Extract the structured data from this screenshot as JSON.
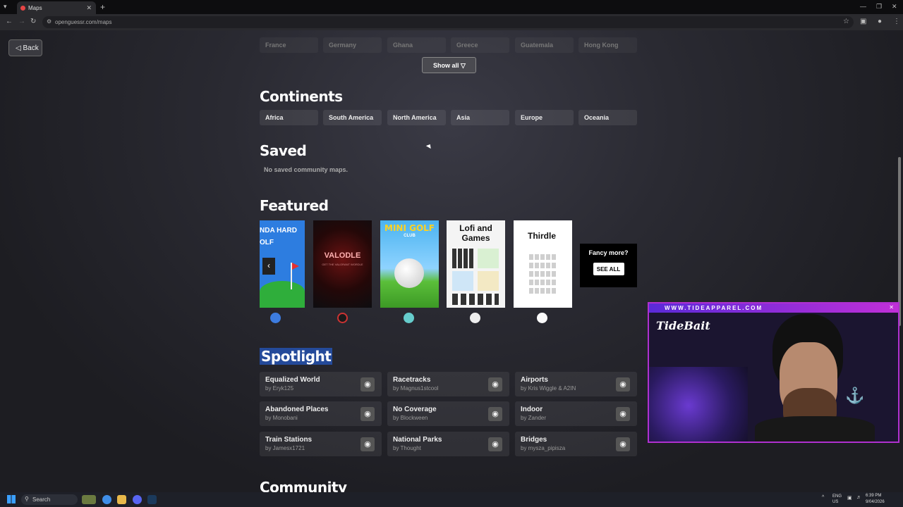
{
  "browser": {
    "tab_title": "Maps",
    "url": "openguessr.com/maps",
    "new_tab_icon": "plus-icon"
  },
  "page": {
    "back_label": "Back",
    "countries_row": [
      "France",
      "Germany",
      "Ghana",
      "Greece",
      "Guatemala",
      "Hong Kong"
    ],
    "show_all_label": "Show all ▽",
    "continents_title": "Continents",
    "continents": [
      "Africa",
      "South America",
      "North America",
      "Asia",
      "Europe",
      "Oceania"
    ],
    "saved_title": "Saved",
    "saved_empty": "No saved community maps.",
    "featured_title": "Featured",
    "featured": [
      {
        "title": "NDA HARD\nOLF"
      },
      {
        "title": "VALODLE",
        "subtitle": "GET THE VALORANT WORDLE"
      },
      {
        "title": "MINI GOLF",
        "subtitle": "CLUB"
      },
      {
        "title": "Lofi and Games"
      },
      {
        "title": "Thirdle"
      }
    ],
    "fancy_more": "Fancy more?",
    "see_all": "SEE ALL",
    "spotlight_title": "Spotlight",
    "spotlight": [
      {
        "name": "Equalized World",
        "author": "by Eryk125"
      },
      {
        "name": "Racetracks",
        "author": "by Magnus1stcool"
      },
      {
        "name": "Airports",
        "author": "by Kris Wiggle & A2IN"
      },
      {
        "name": "Abandoned Places",
        "author": "by Monobani"
      },
      {
        "name": "No Coverage",
        "author": "by Blockween"
      },
      {
        "name": "Indoor",
        "author": "by Zander"
      },
      {
        "name": "Train Stations",
        "author": "by Jamesx1721"
      },
      {
        "name": "National Parks",
        "author": "by Thought"
      },
      {
        "name": "Bridges",
        "author": "by mysza_pipisza"
      }
    ],
    "community_title": "Community"
  },
  "webcam": {
    "banner": "WWW.TIDEAPPAREL.COM",
    "logo": "TideBait"
  },
  "taskbar": {
    "search_label": "Search",
    "lang": "ENG\nUS",
    "time": "6:39 PM",
    "date": "9/04/2026"
  }
}
